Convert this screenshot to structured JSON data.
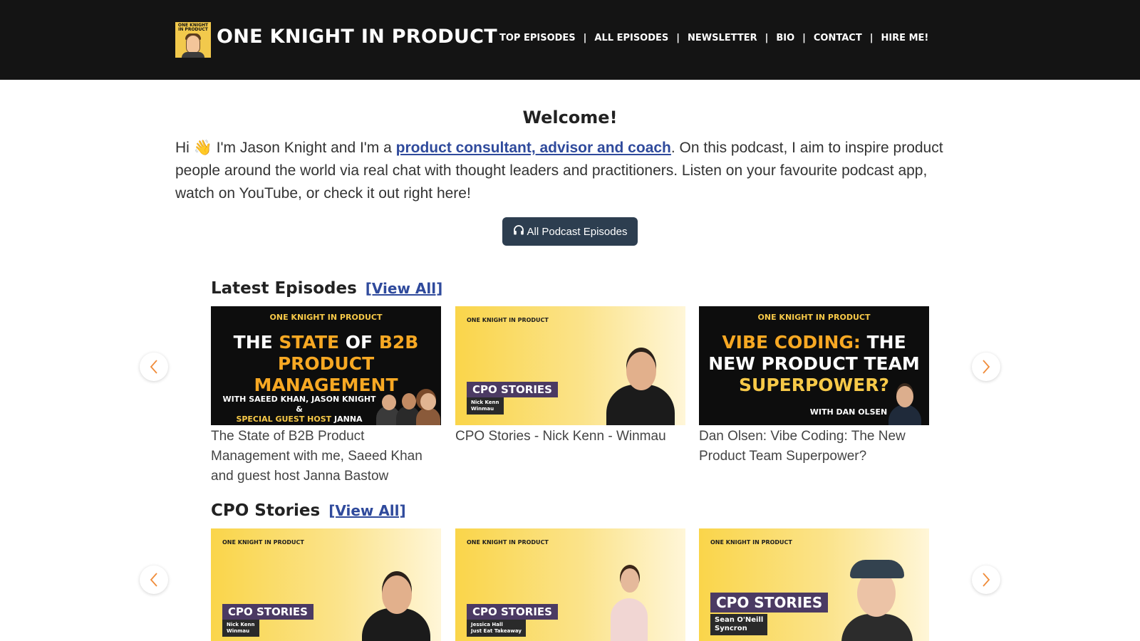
{
  "header": {
    "logo_text": "ONE KNIGHT IN PRODUCT",
    "brand": "ONE KNIGHT IN PRODUCT",
    "nav": [
      "TOP EPISODES",
      "ALL EPISODES",
      "NEWSLETTER",
      "BIO",
      "CONTACT",
      "HIRE ME!"
    ],
    "nav_separator": "|"
  },
  "welcome": {
    "title": "Welcome!",
    "intro_before": "Hi ",
    "wave": "👋",
    "intro_mid": " I'm Jason Knight and I'm a ",
    "intro_link": "product consultant, advisor and coach",
    "intro_after": ". On this podcast, I aim to inspire product people around the world via real chat with thought leaders and practitioners. Listen on your favourite podcast app, watch on YouTube, or check it out right here!",
    "cta_label": "All Podcast Episodes",
    "cta_icon": "headphones-icon"
  },
  "latest": {
    "title": "Latest Episodes",
    "view_all": "[View All]",
    "cards": [
      {
        "brand": "ONE KNIGHT IN PRODUCT",
        "headline_1a": "THE ",
        "headline_1b": "STATE",
        "headline_1c": " OF ",
        "headline_1d": "B2B",
        "headline_2": "PRODUCT MANAGEMENT",
        "sub_1": "WITH SAEED KHAN, JASON KNIGHT &",
        "sub_2a": "SPECIAL GUEST HOST",
        "sub_2b": " JANNA BASTOW",
        "caption": "The State of B2B Product Management with me, Saeed Khan and guest host Janna Bastow"
      },
      {
        "brand": "ONE KNIGHT IN PRODUCT",
        "tag": "CPO STORIES",
        "name": "Nick Kenn\nWinmau",
        "caption": "CPO Stories - Nick Kenn - Winmau"
      },
      {
        "brand": "ONE KNIGHT IN PRODUCT",
        "headline_1a": "VIBE CODING:",
        "headline_1b": " THE",
        "headline_2": "NEW PRODUCT TEAM",
        "headline_3": "SUPERPOWER?",
        "sub": "WITH DAN OLSEN",
        "caption": "Dan Olsen: Vibe Coding: The New Product Team Superpower?"
      }
    ]
  },
  "cpo": {
    "title": "CPO Stories",
    "view_all": "[View All]",
    "cards": [
      {
        "brand": "ONE KNIGHT IN PRODUCT",
        "tag": "CPO STORIES",
        "name": "Nick Kenn\nWinmau"
      },
      {
        "brand": "ONE KNIGHT IN PRODUCT",
        "tag": "CPO STORIES",
        "name": "Jessica Hall\nJust Eat Takeaway"
      },
      {
        "brand": "ONE KNIGHT IN PRODUCT",
        "tag": "CPO STORIES",
        "name": "Sean O'Neill\nSyncron"
      }
    ]
  },
  "colors": {
    "header_bg": "#141414",
    "link": "#2f4a9c",
    "cta_bg": "#2d3e50",
    "accent_orange": "#f7a823",
    "accent_yellow": "#f7c948",
    "cpo_tag": "#4b3a63"
  },
  "icons": {
    "prev": "chevron-left-icon",
    "next": "chevron-right-icon"
  }
}
